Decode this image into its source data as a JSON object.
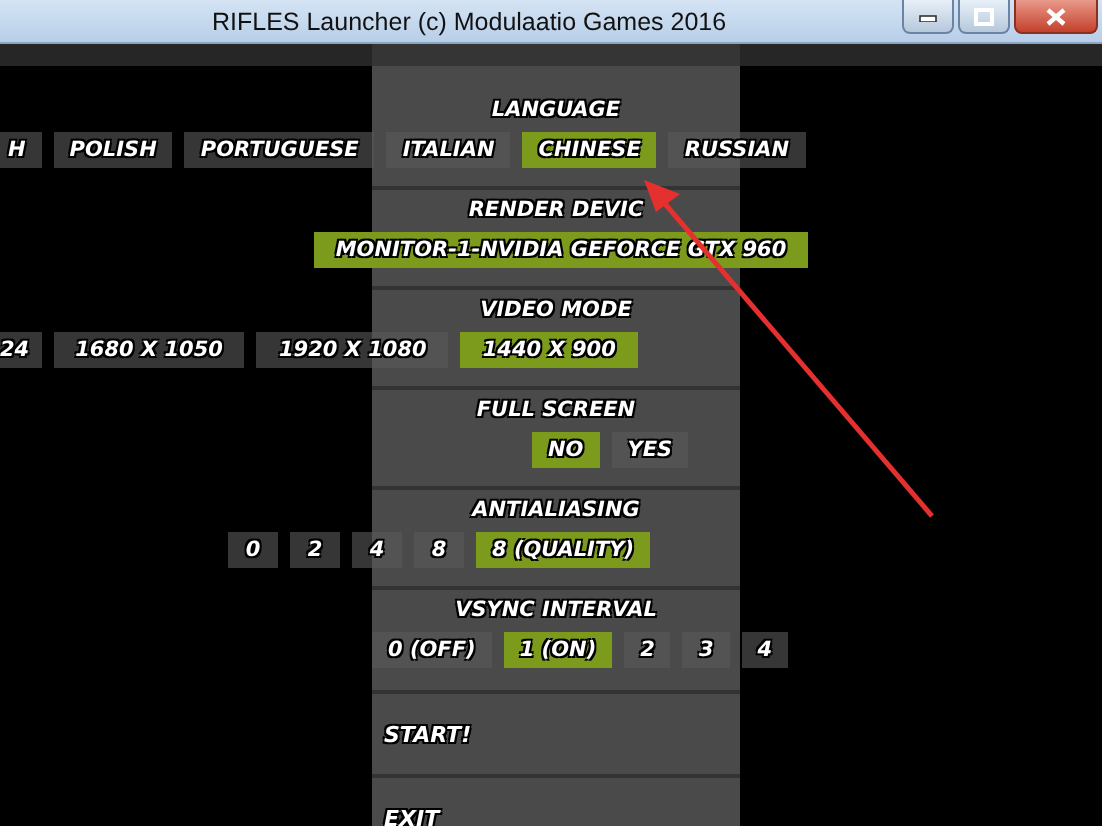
{
  "window": {
    "title": "RIFLES Launcher (c) Modulaatio Games 2016"
  },
  "sections": [
    {
      "title": "LANGUAGE",
      "options": [
        {
          "label": "H",
          "selected": false
        },
        {
          "label": "POLISH",
          "selected": false
        },
        {
          "label": "PORTUGUESE",
          "selected": false
        },
        {
          "label": "ITALIAN",
          "selected": false
        },
        {
          "label": "CHINESE",
          "selected": true
        },
        {
          "label": "RUSSIAN",
          "selected": false
        }
      ]
    },
    {
      "title": "RENDER DEVIC",
      "options": [
        {
          "label": "MONITOR-1-NVIDIA GEFORCE GTX 960",
          "selected": true
        }
      ]
    },
    {
      "title": "VIDEO MODE",
      "options": [
        {
          "label": "24",
          "selected": false
        },
        {
          "label": "1680 X 1050",
          "selected": false
        },
        {
          "label": "1920 X 1080",
          "selected": false
        },
        {
          "label": "1440 X 900",
          "selected": true
        }
      ]
    },
    {
      "title": "FULL SCREEN",
      "options": [
        {
          "label": "NO",
          "selected": true
        },
        {
          "label": "YES",
          "selected": false
        }
      ]
    },
    {
      "title": "ANTIALIASING",
      "options": [
        {
          "label": "0",
          "selected": false
        },
        {
          "label": "2",
          "selected": false
        },
        {
          "label": "4",
          "selected": false
        },
        {
          "label": "8",
          "selected": false
        },
        {
          "label": "8 (QUALITY)",
          "selected": true
        }
      ]
    },
    {
      "title": "VSYNC INTERVAL",
      "options": [
        {
          "label": "0 (OFF)",
          "selected": false
        },
        {
          "label": "1 (ON)",
          "selected": true
        },
        {
          "label": "2",
          "selected": false
        },
        {
          "label": "3",
          "selected": false
        },
        {
          "label": "4",
          "selected": false
        }
      ]
    }
  ],
  "actions": [
    {
      "label": "START!"
    },
    {
      "label": "EXIT"
    }
  ]
}
